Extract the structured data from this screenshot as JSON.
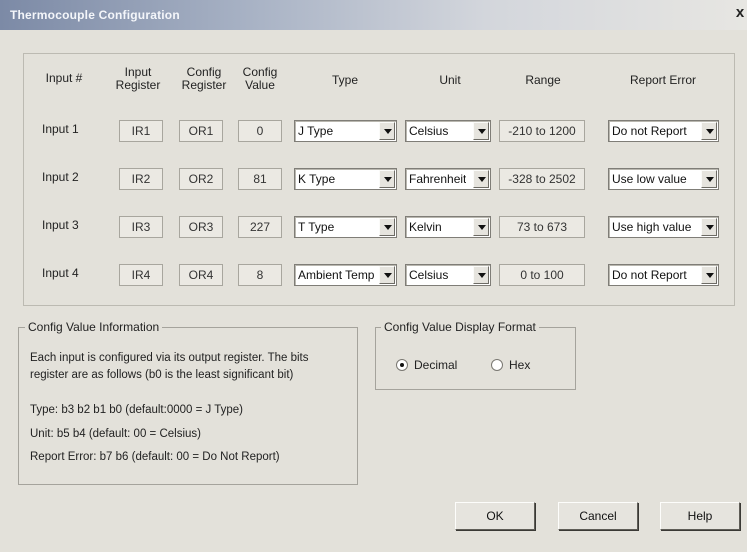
{
  "window": {
    "title": "Thermocouple Configuration",
    "close_glyph": "x"
  },
  "headers": {
    "input_no": "Input #",
    "input_register": [
      "Input",
      "Register"
    ],
    "config_register": [
      "Config",
      "Register"
    ],
    "config_value": [
      "Config",
      "Value"
    ],
    "type": "Type",
    "unit": "Unit",
    "range": "Range",
    "report_error": "Report Error"
  },
  "rows": [
    {
      "label": "Input 1",
      "input_register": "IR1",
      "config_register": "OR1",
      "config_value": "0",
      "type": "J Type",
      "unit": "Celsius",
      "range": "-210 to 1200",
      "report_error": "Do not Report"
    },
    {
      "label": "Input 2",
      "input_register": "IR2",
      "config_register": "OR2",
      "config_value": "81",
      "type": "K Type",
      "unit": "Fahrenheit",
      "range": "-328 to 2502",
      "report_error": "Use low value"
    },
    {
      "label": "Input 3",
      "input_register": "IR3",
      "config_register": "OR3",
      "config_value": "227",
      "type": "T Type",
      "unit": "Kelvin",
      "range": "73 to 673",
      "report_error": "Use high value"
    },
    {
      "label": "Input 4",
      "input_register": "IR4",
      "config_register": "OR4",
      "config_value": "8",
      "type": "Ambient Temp",
      "unit": "Celsius",
      "range": "0 to 100",
      "report_error": "Do not Report"
    }
  ],
  "info": {
    "legend": "Config Value Information",
    "line1": "Each input is configured via its output register.  The bits",
    "line2": "register are as follows (b0 is the least significant bit)",
    "type_line": "Type: b3 b2 b1 b0 (default:0000 = J Type)",
    "unit_line": "Unit: b5 b4 (default: 00 = Celsius)",
    "report_line": "Report Error: b7 b6 (default: 00 = Do Not Report)"
  },
  "format": {
    "legend": "Config Value Display Format",
    "decimal_label": "Decimal",
    "hex_label": "Hex",
    "selected": "Decimal"
  },
  "buttons": {
    "ok": "OK",
    "cancel": "Cancel",
    "help": "Help"
  }
}
